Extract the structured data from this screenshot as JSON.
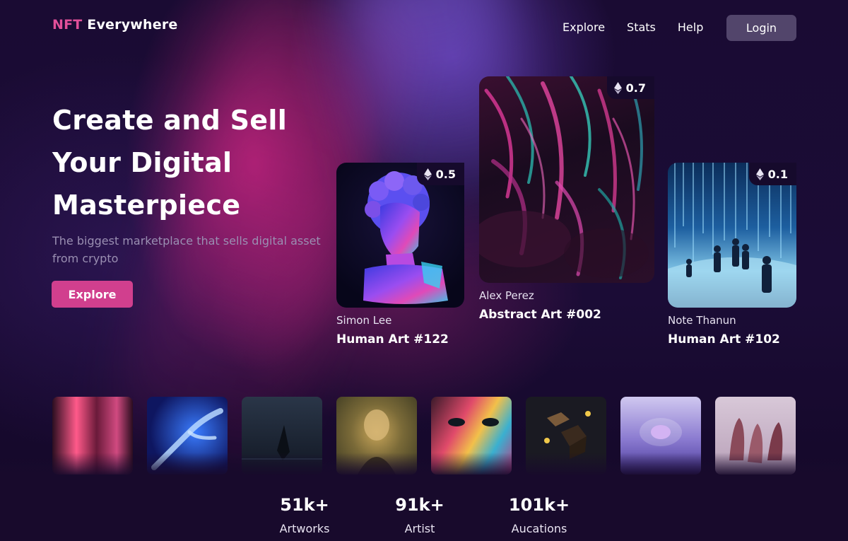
{
  "header": {
    "logo_accent": "NFT",
    "logo_rest": " Everywhere",
    "nav": [
      {
        "label": "Explore"
      },
      {
        "label": "Stats"
      },
      {
        "label": "Help"
      }
    ],
    "login_label": "Login"
  },
  "hero": {
    "title_lines": [
      "Create and Sell",
      "Your Digital",
      "Masterpiece"
    ],
    "subtitle": "The biggest marketplace that sells digital asset from crypto",
    "cta_label": "Explore"
  },
  "cards": [
    {
      "price": "0.5",
      "author": "Simon Lee",
      "title": "Human Art #122"
    },
    {
      "price": "0.7",
      "author": "Alex Perez",
      "title": "Abstract Art #002"
    },
    {
      "price": "0.1",
      "author": "Note Thanun",
      "title": "Human Art #102"
    }
  ],
  "thumbnails": [
    {
      "name": "neon-corridor"
    },
    {
      "name": "blue-hand"
    },
    {
      "name": "dark-pyramid"
    },
    {
      "name": "pixel-mona-lisa"
    },
    {
      "name": "painted-face"
    },
    {
      "name": "floating-cubes"
    },
    {
      "name": "glowing-brain"
    },
    {
      "name": "melting-figures"
    }
  ],
  "stats": [
    {
      "value": "51k+",
      "label": "Artworks"
    },
    {
      "value": "91k+",
      "label": "Artist"
    },
    {
      "value": "101k+",
      "label": "Aucations"
    }
  ],
  "colors": {
    "accent": "#d13f8e",
    "logo_accent": "#e2509a",
    "background": "#1a0b33"
  },
  "icons": {
    "price": "ethereum-icon"
  }
}
